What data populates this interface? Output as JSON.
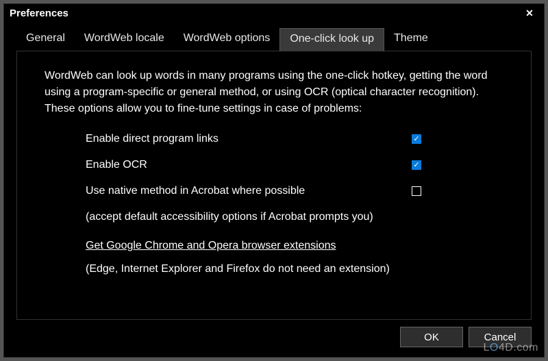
{
  "window": {
    "title": "Preferences",
    "close_glyph": "✕"
  },
  "tabs": {
    "items": [
      {
        "label": "General"
      },
      {
        "label": "WordWeb locale"
      },
      {
        "label": "WordWeb options"
      },
      {
        "label": "One-click look up"
      },
      {
        "label": "Theme"
      }
    ],
    "active_index": 3
  },
  "panel": {
    "description": "WordWeb can look up words in many programs using the one-click hotkey, getting the word using a program-specific or general method, or using OCR (optical character recognition). These options allow you to fine-tune settings in case of problems:",
    "options": [
      {
        "label": "Enable direct program links",
        "checked": true
      },
      {
        "label": "Enable OCR",
        "checked": true
      },
      {
        "label": "Use native method in Acrobat where possible",
        "checked": false
      }
    ],
    "acrobat_note": "(accept default accessibility options if Acrobat prompts you)",
    "ext_link": "Get Google Chrome and Opera browser extensions",
    "ext_note": "(Edge, Internet Explorer and Firefox do not need an extension)"
  },
  "buttons": {
    "ok": "OK",
    "cancel": "Cancel"
  },
  "watermark": "LO4D.com"
}
